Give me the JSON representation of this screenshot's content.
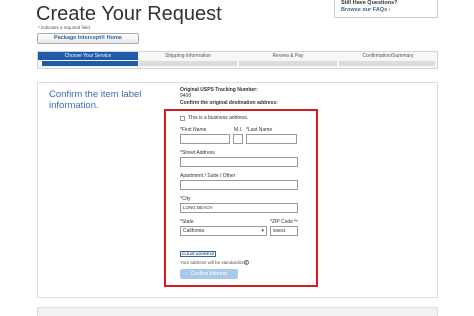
{
  "page": {
    "title": "Create Your Request"
  },
  "help": {
    "title": "Still Have Questions?",
    "link": "Browse our FAQs ›"
  },
  "required_note": "* indicates a required field",
  "home_button": "Package Intercept® Home",
  "steps": [
    {
      "label": "Choose Your Service",
      "active": true
    },
    {
      "label": "Shipping Information",
      "active": false
    },
    {
      "label": "Review & Pay",
      "active": false
    },
    {
      "label": "Confirmation/Summary",
      "active": false
    }
  ],
  "main": {
    "heading": "Confirm the item label information.",
    "tracking_label": "Original USPS Tracking Number:",
    "tracking_value": "9400",
    "confirm_label": "Confirm the original destination address:"
  },
  "form": {
    "business_checkbox_label": "This is a business address.",
    "business_checked": false,
    "first_name_label": "*First Name",
    "mi_label": "M.I.",
    "last_name_label": "*Last Name",
    "first_name_value": "",
    "mi_value": "",
    "last_name_value": "",
    "street_label": "*Street Address",
    "street_value": "",
    "apt_label": "Apartment / Suite / Other",
    "apt_value": "",
    "city_label": "*City",
    "city_value": "LONG BEACH",
    "state_label": "*State",
    "state_value": "California",
    "zip_label": "*ZIP Code™",
    "zip_value": "90803",
    "clear_button": "CLEAR ADDRESS",
    "standardized_note": "Your address will be standardized",
    "confirm_button": "Confirm Address"
  },
  "colors": {
    "accent": "#1f5ba9",
    "heading": "#3a6fb0",
    "highlight_box": "#d81a25",
    "confirm_button": "#a9c9ea"
  }
}
